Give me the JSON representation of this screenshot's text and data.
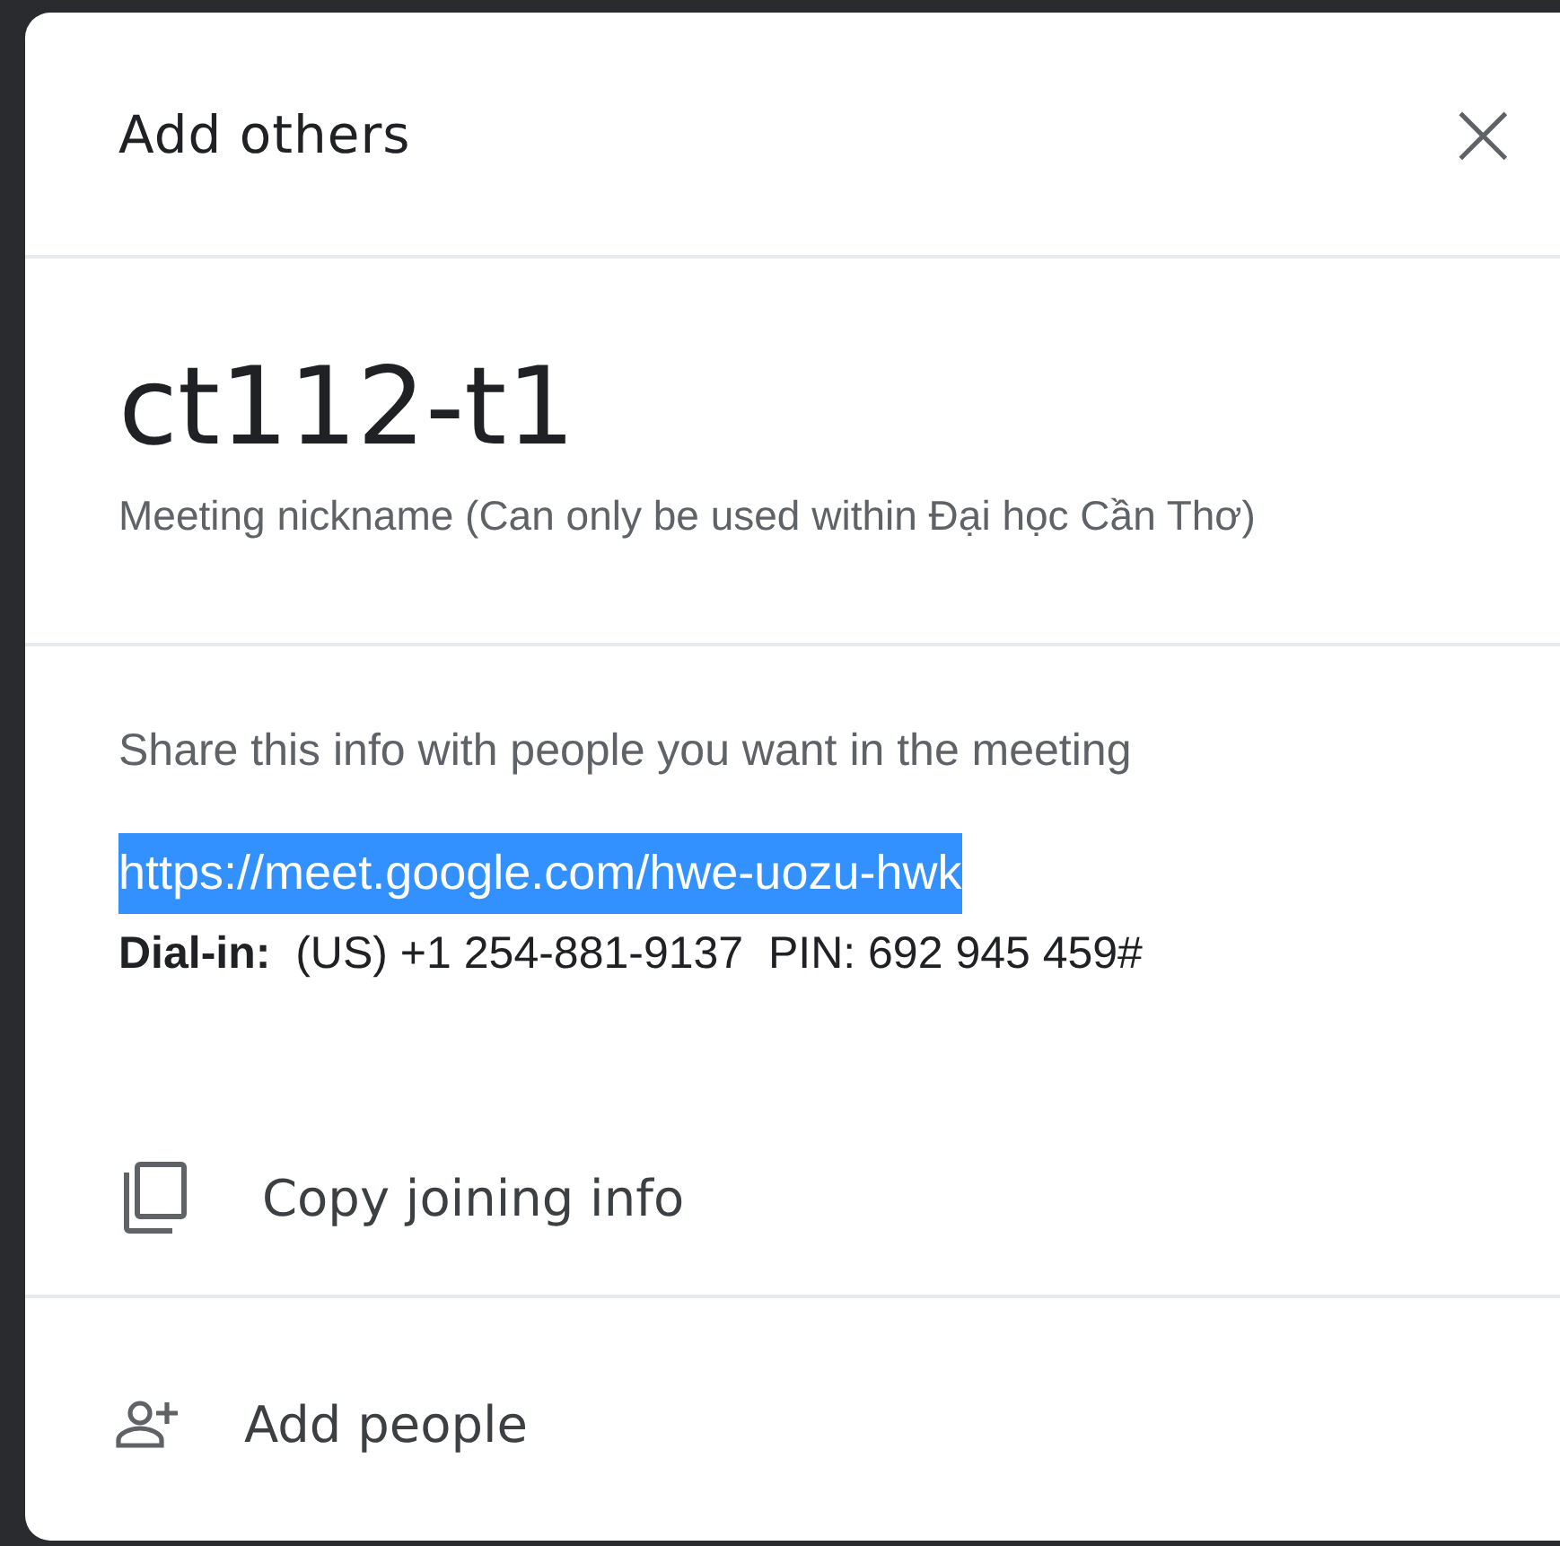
{
  "dialog": {
    "title": "Add others",
    "close_label": "×"
  },
  "meeting": {
    "nickname": "ct112-t1",
    "note": "Meeting nickname (Can only be used within Đại học Cần Thơ)"
  },
  "share": {
    "intro": "Share this info with people you want in the meeting",
    "link": {
      "text": "https://meet.google.com/hwe-uozu-hwk",
      "selected": true
    },
    "dial_in": "**Dial-in:**  (US) +1 254-881-9137  PIN: 692 945 459#"
  },
  "actions": [
    {
      "kind": "copy",
      "label": "Copy joining info"
    },
    {
      "kind": "add_people",
      "label": "Add people"
    }
  ]
}
